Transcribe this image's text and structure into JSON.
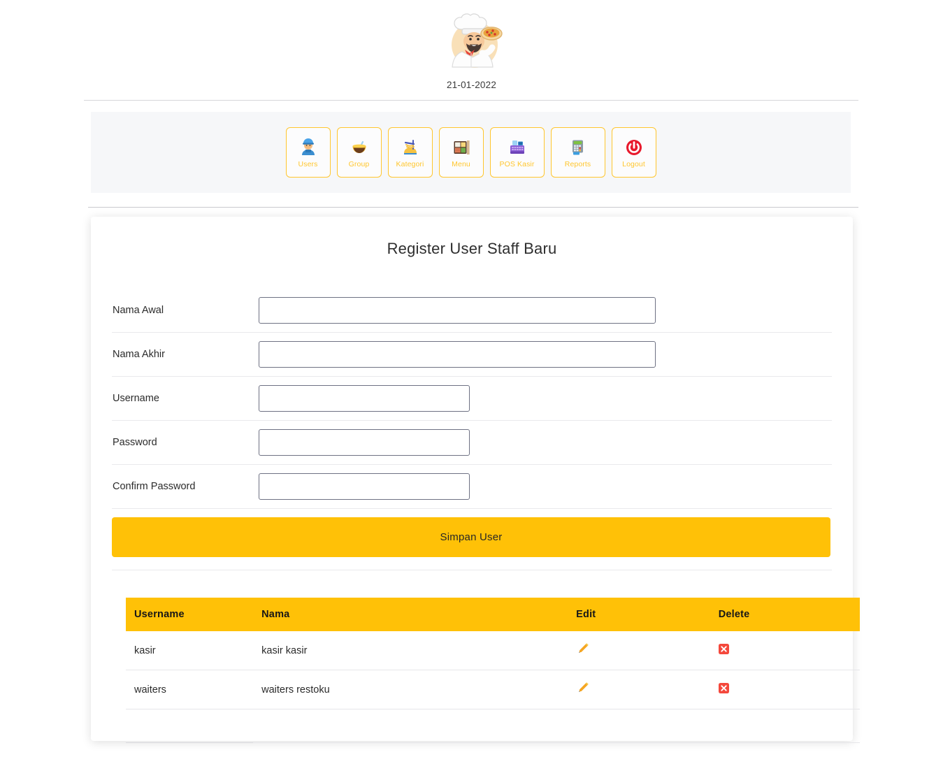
{
  "brand": {
    "logo_icon": "pizza-chef-logo",
    "date": "21-01-2022"
  },
  "nav": {
    "items": [
      {
        "label": "Users",
        "icon": "construction-worker-icon"
      },
      {
        "label": "Group",
        "icon": "rice-bowl-icon"
      },
      {
        "label": "Kategori",
        "icon": "spaghetti-icon"
      },
      {
        "label": "Menu",
        "icon": "bento-box-icon"
      },
      {
        "label": "POS Kasir",
        "icon": "cash-register-icon"
      },
      {
        "label": "Reports",
        "icon": "pos-terminal-icon"
      },
      {
        "label": "Logout",
        "icon": "power-off-icon"
      }
    ]
  },
  "main": {
    "title": "Register User Staff Baru",
    "fields": [
      {
        "label": "Nama Awal",
        "value": "",
        "placeholder": "",
        "size": "lg",
        "type": "text"
      },
      {
        "label": "Nama Akhir",
        "value": "",
        "placeholder": "",
        "size": "lg",
        "type": "text"
      },
      {
        "label": "Username",
        "value": "",
        "placeholder": "",
        "size": "sm",
        "type": "text"
      },
      {
        "label": "Password",
        "value": "",
        "placeholder": "",
        "size": "sm",
        "type": "password"
      },
      {
        "label": "Confirm Password",
        "value": "",
        "placeholder": "",
        "size": "sm",
        "type": "password"
      }
    ],
    "submit_label": "Simpan User"
  },
  "table": {
    "headers": [
      "Username",
      "Nama",
      "Edit",
      "Delete"
    ],
    "rows": [
      {
        "username": "kasir",
        "nama": "kasir kasir",
        "edit_icon": "pencil-icon",
        "delete_icon": "cross-mark-icon"
      },
      {
        "username": "waiters",
        "nama": "waiters restoku",
        "edit_icon": "pencil-icon",
        "delete_icon": "cross-mark-icon"
      }
    ]
  },
  "colors": {
    "accent_yellow": "#ffc107",
    "nav_border_yellow": "#ffc62e",
    "nav_bg": "#f6f7f9",
    "delete_red": "#f4483c",
    "input_border": "#6e7183"
  }
}
